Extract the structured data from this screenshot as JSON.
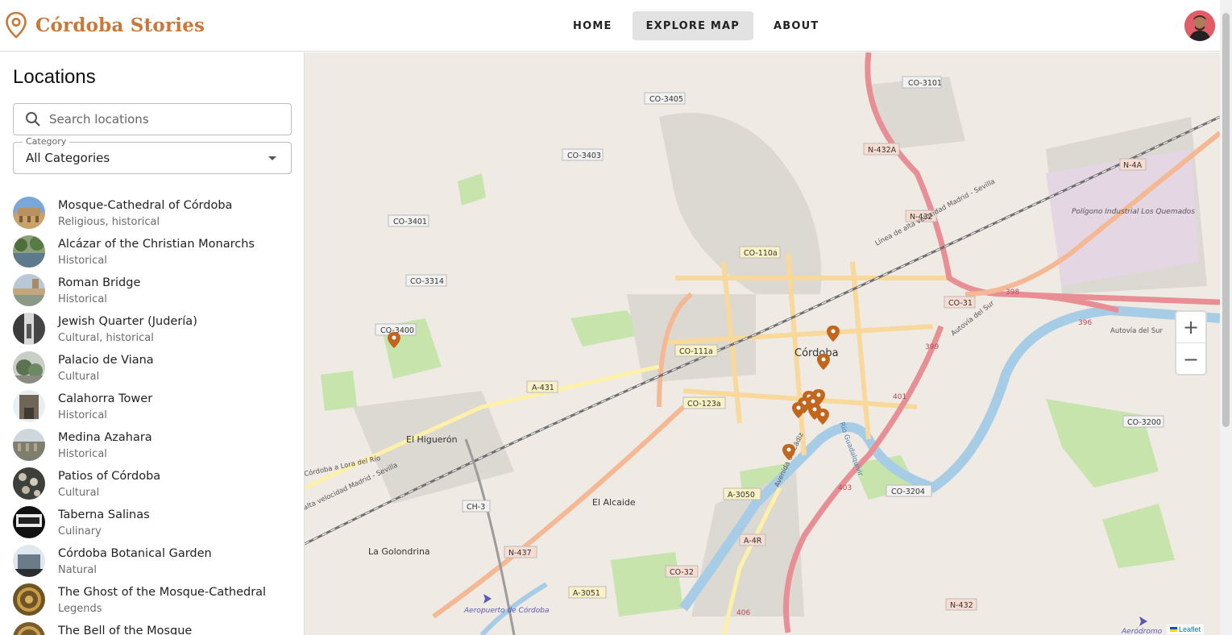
{
  "app": {
    "title": "Córdoba Stories",
    "accent": "#c8793a"
  },
  "nav": [
    {
      "label": "HOME",
      "active": false
    },
    {
      "label": "EXPLORE MAP",
      "active": true
    },
    {
      "label": "ABOUT",
      "active": false
    }
  ],
  "sidebar": {
    "title": "Locations",
    "search_placeholder": "Search locations",
    "category_label": "Category",
    "category_value": "All Categories",
    "items": [
      {
        "name": "Mosque-Cathedral of Córdoba",
        "category": "Religious, historical"
      },
      {
        "name": "Alcázar of the Christian Monarchs",
        "category": "Historical"
      },
      {
        "name": "Roman Bridge",
        "category": "Historical"
      },
      {
        "name": "Jewish Quarter (Judería)",
        "category": "Cultural, historical"
      },
      {
        "name": "Palacio de Viana",
        "category": "Cultural"
      },
      {
        "name": "Calahorra Tower",
        "category": "Historical"
      },
      {
        "name": "Medina Azahara",
        "category": "Historical"
      },
      {
        "name": "Patios of Córdoba",
        "category": "Cultural"
      },
      {
        "name": "Taberna Salinas",
        "category": "Culinary"
      },
      {
        "name": "Córdoba Botanical Garden",
        "category": "Natural"
      },
      {
        "name": "The Ghost of the Mosque-Cathedral",
        "category": "Legends"
      },
      {
        "name": "The Bell of the Mosque",
        "category": ""
      }
    ]
  },
  "map": {
    "city_label": "Córdoba",
    "place_labels": [
      "El Higuerón",
      "El Alcaide",
      "La Golondrina",
      "Polígono Industrial Los Quemados",
      "Aeropuerto de Córdoba",
      "Aeródromo"
    ],
    "road_labels": [
      "CO-3101",
      "CO-3405",
      "CO-3403",
      "N-432A",
      "N-4A",
      "CO-3401",
      "N-432",
      "CO-110a",
      "CO-3314",
      "CO-31",
      "CO-3400",
      "CO-111a",
      "A-431",
      "CO-123a",
      "CO-3200",
      "CH-3",
      "A-3050",
      "CO-3204",
      "A-4R",
      "N-437",
      "CO-32",
      "A-3051",
      "N-432",
      "398",
      "396",
      "399",
      "401",
      "403",
      "406"
    ],
    "rail_labels": [
      "Línea de alta velocidad Madrid - Sevilla",
      "alta velocidad Madrid - Sevilla",
      "Córdoba a Lora del Río"
    ],
    "street_labels": [
      "Autovía del Sur",
      "Avenida de Cádiz",
      "Río Guadalquivir",
      "Autovía del Sur"
    ],
    "zoom_in": "+",
    "zoom_out": "−",
    "attribution": "Leaflet"
  }
}
